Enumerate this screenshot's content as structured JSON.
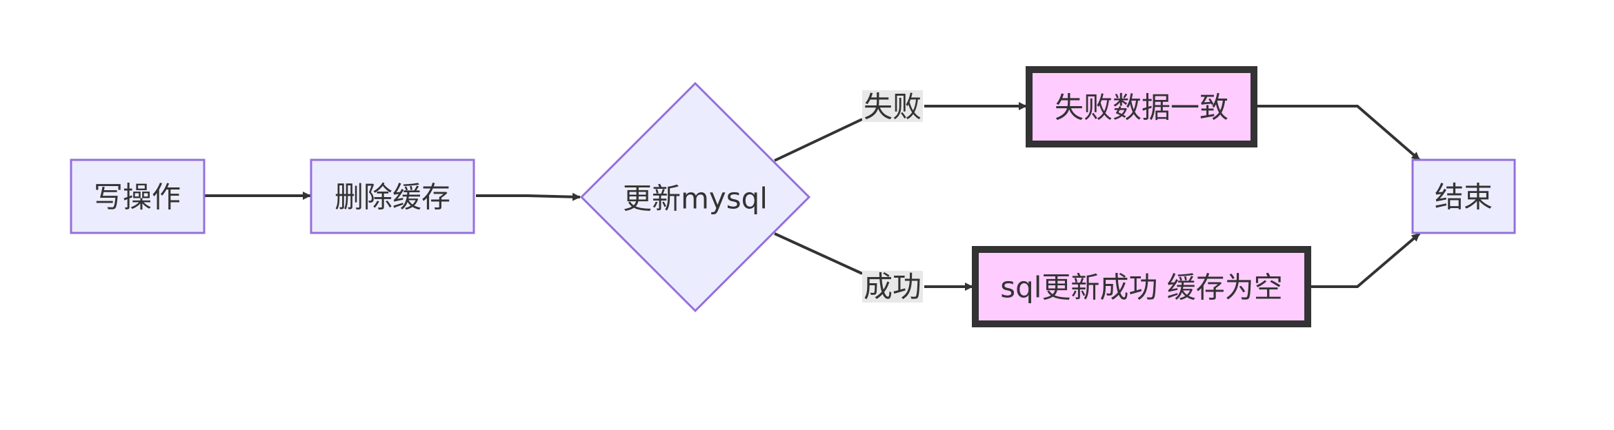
{
  "diagram": {
    "nodes": {
      "write_op": {
        "label": "写操作"
      },
      "delete_cache": {
        "label": "删除缓存"
      },
      "update_mysql": {
        "label": "更新mysql"
      },
      "fail_consistent": {
        "label": "失败数据一致"
      },
      "success_empty": {
        "label": "sql更新成功 缓存为空"
      },
      "end": {
        "label": "结束"
      }
    },
    "edges": {
      "fail": {
        "label": "失败"
      },
      "success": {
        "label": "成功"
      }
    },
    "colors": {
      "node_fill": "#ececff",
      "node_stroke": "#9370db",
      "highlight_fill": "#ffccff",
      "highlight_stroke": "#333333",
      "edge": "#333333",
      "edge_label_bg": "#e8e8e8",
      "text": "#333333"
    }
  }
}
